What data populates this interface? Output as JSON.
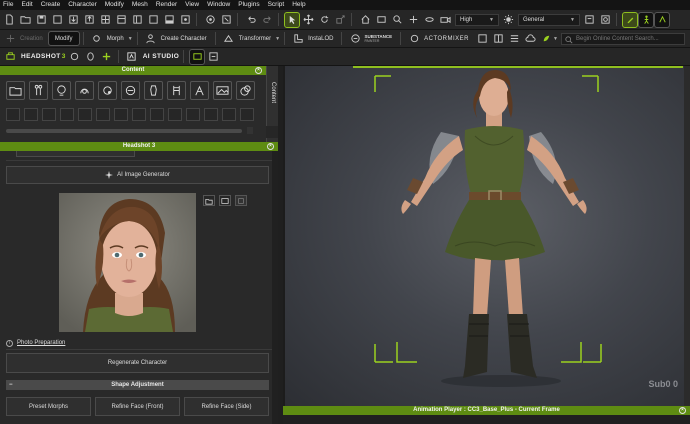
{
  "menu": [
    "File",
    "Edit",
    "Create",
    "Character",
    "Modify",
    "Mesh",
    "Render",
    "View",
    "Window",
    "Plugins",
    "Script",
    "Help"
  ],
  "toolbar": {
    "quality": "High",
    "view_mode": "General"
  },
  "toolbar2": {
    "creation": "Creation",
    "modify": "Modify",
    "morph": "Morph",
    "create_character": "Create Character",
    "transformer": "Transformer",
    "instalod": "InstaLOD",
    "substance_top": "SUBSTANCE",
    "substance_bottom": "PAINTER",
    "actormixer": "ACTORMIXER",
    "search_placeholder": "Begin Online Content Search..."
  },
  "toolbar3": {
    "headshot": "HEADSHOT",
    "headshot_num": "3",
    "ai_studio": "AI STUDIO"
  },
  "content_panel": {
    "title": "Content",
    "side_tab": "Content"
  },
  "headshot_panel": {
    "title": "Headshot 3",
    "ai_image_generator": "AI Image Generator",
    "photo_preparation": "Photo Preparation",
    "regenerate": "Regenerate Character",
    "shape_adjustment": "Shape Adjustment",
    "preset_morphs": "Preset Morphs",
    "refine_front": "Refine Face (Front)",
    "refine_side": "Refine Face (Side)"
  },
  "viewport": {
    "subd_label": "Sub0",
    "subd_value": "0"
  },
  "animation_player": {
    "title": "Animation Player : CC3_Base_Plus - Current Frame"
  },
  "colors": {
    "accent": "#8fbf1f",
    "panel_header": "#5e8c12"
  }
}
